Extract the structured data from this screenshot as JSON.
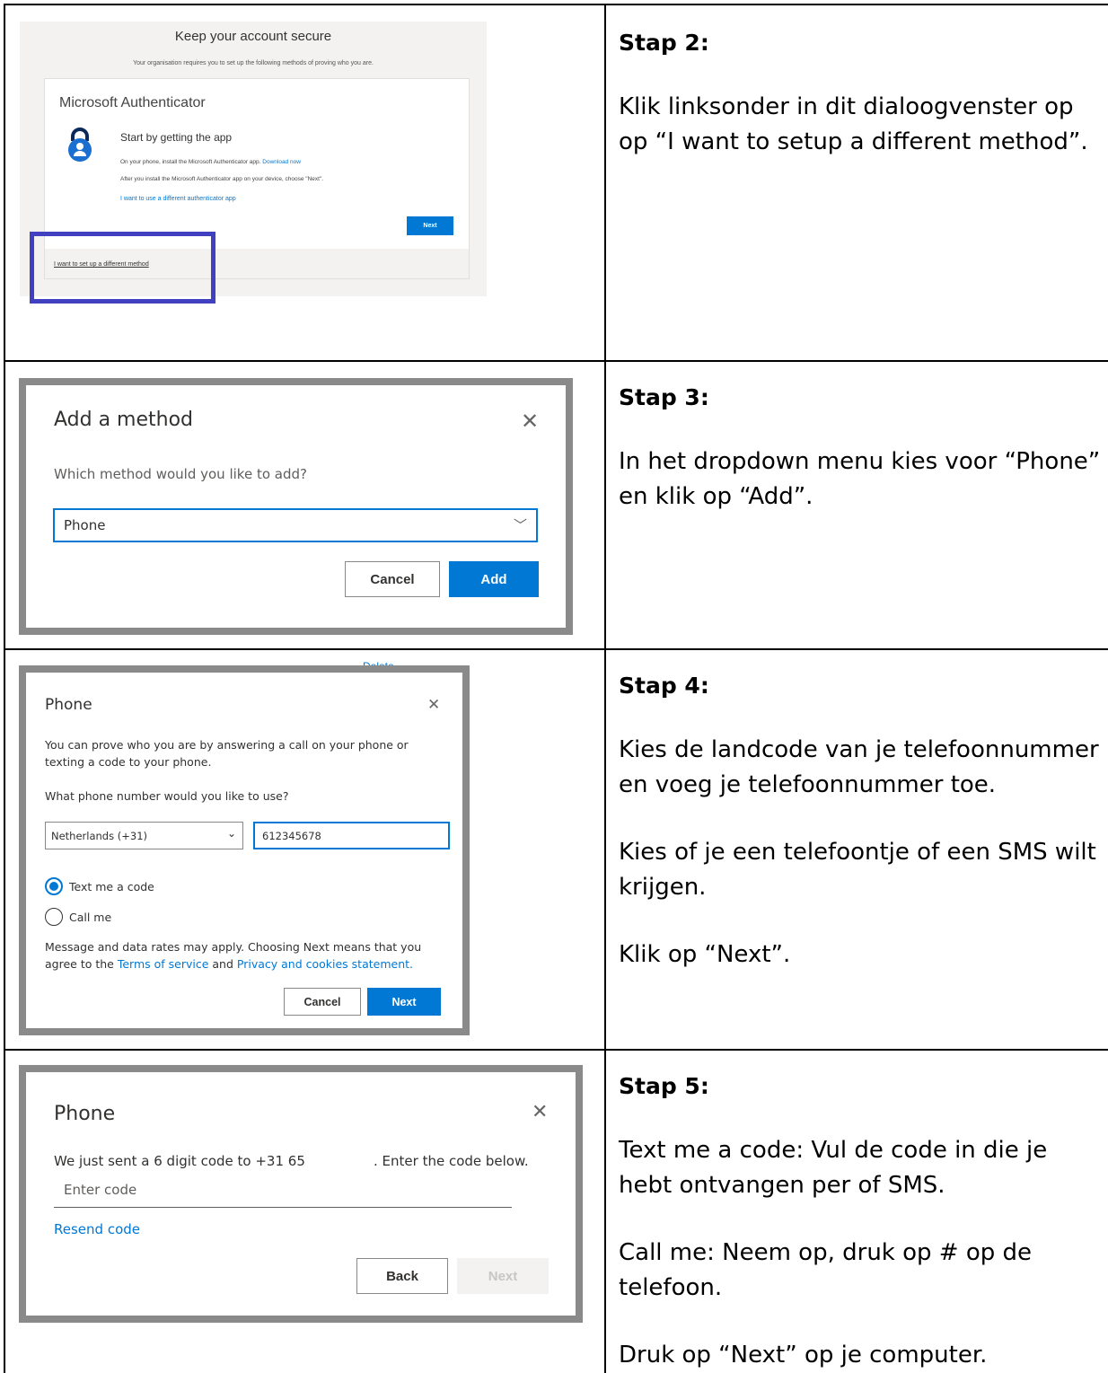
{
  "steps": [
    {
      "title": "Stap 2:",
      "paragraphs": [
        "Klik linksonder in dit dialoogvenster op op “I want to setup a different method”."
      ],
      "screenshot": {
        "heading": "Keep your account secure",
        "subheading": "Your organisation requires you to set up the following methods of proving who you are.",
        "card_title": "Microsoft Authenticator",
        "card_subtitle": "Start by getting the app",
        "line1": "On your phone, install the Microsoft Authenticator app.",
        "line1_link": "Download now",
        "line2": "After you install the Microsoft Authenticator app on your device, choose \"Next\".",
        "alt_link": "I want to use a different authenticator app",
        "next_label": "Next",
        "different_method_link": "I want to set up a different method"
      }
    },
    {
      "title": "Stap 3:",
      "paragraphs": [
        "In het dropdown menu kies voor “Phone” en klik op “Add”."
      ],
      "screenshot": {
        "title": "Add a method",
        "question": "Which method would you like to add?",
        "selected": "Phone",
        "cancel_label": "Cancel",
        "add_label": "Add"
      }
    },
    {
      "title": "Stap 4:",
      "paragraphs": [
        "Kies de landcode van je telefoonnummer en voeg je telefoonnummer toe.",
        "Kies of je een telefoontje of een SMS wilt krijgen.",
        "Klik op “Next”."
      ],
      "screenshot": {
        "bg_text": "Delete",
        "title": "Phone",
        "intro": "You can prove who you are by answering a call on your phone or texting a code to your phone.",
        "question": "What phone number would you like to use?",
        "country": "Netherlands (+31)",
        "number": "612345678",
        "option1": "Text me a code",
        "option2": "Call me",
        "disclaimer_pre": "Message and data rates may apply. Choosing Next means that you agree to the ",
        "terms_link": "Terms of service",
        "and": " and ",
        "privacy_link": "Privacy and cookies statement.",
        "cancel_label": "Cancel",
        "next_label": "Next"
      }
    },
    {
      "title": "Stap 5:",
      "paragraphs": [
        "Text me a code: Vul de code in die je hebt ontvangen per of SMS.",
        "Call me: Neem op, druk op # op de telefoon.",
        "Druk op “Next” op je computer."
      ],
      "screenshot": {
        "title": "Phone",
        "sent_pre": "We just sent a 6 digit code to +31 65",
        "sent_post": ". Enter the code below.",
        "placeholder": "Enter code",
        "resend": "Resend code",
        "back_label": "Back",
        "next_label": "Next"
      }
    }
  ],
  "icons": {
    "close": "close-icon",
    "chevron": "chevron-down-icon",
    "authenticator": "authenticator-lock-icon"
  },
  "colors": {
    "primary": "#0078d4",
    "highlight": "#4040c0",
    "frame": "#8a8a8a"
  }
}
